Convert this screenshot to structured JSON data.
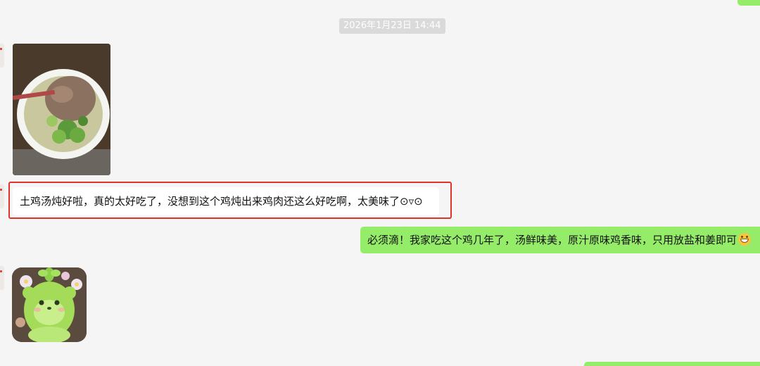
{
  "chat": {
    "timestamp": "2026年1月23日 14:44",
    "messages": [
      {
        "sender": "contact",
        "type": "image",
        "icon": "chicken-soup-photo"
      },
      {
        "sender": "contact",
        "type": "text",
        "text": "土鸡汤炖好啦，真的太好吃了，没想到这个鸡炖出来鸡肉还这么好吃啊，太美味了⊙▿⊙",
        "highlighted": true
      },
      {
        "sender": "me",
        "type": "text",
        "text": "必须滴！我家吃这个鸡几年了，汤鲜味美，原汁原味鸡香味，只用放盐和姜即可",
        "emoji": "grinning-face-icon"
      },
      {
        "sender": "contact",
        "type": "sticker",
        "icon": "green-bear-sprout-sticker"
      }
    ]
  },
  "colors": {
    "background": "#f5f5f5",
    "outgoing_bubble": "#95ec69",
    "incoming_bubble": "#ffffff",
    "highlight_border": "#e0332c",
    "timestamp_bg": "#dadada"
  }
}
